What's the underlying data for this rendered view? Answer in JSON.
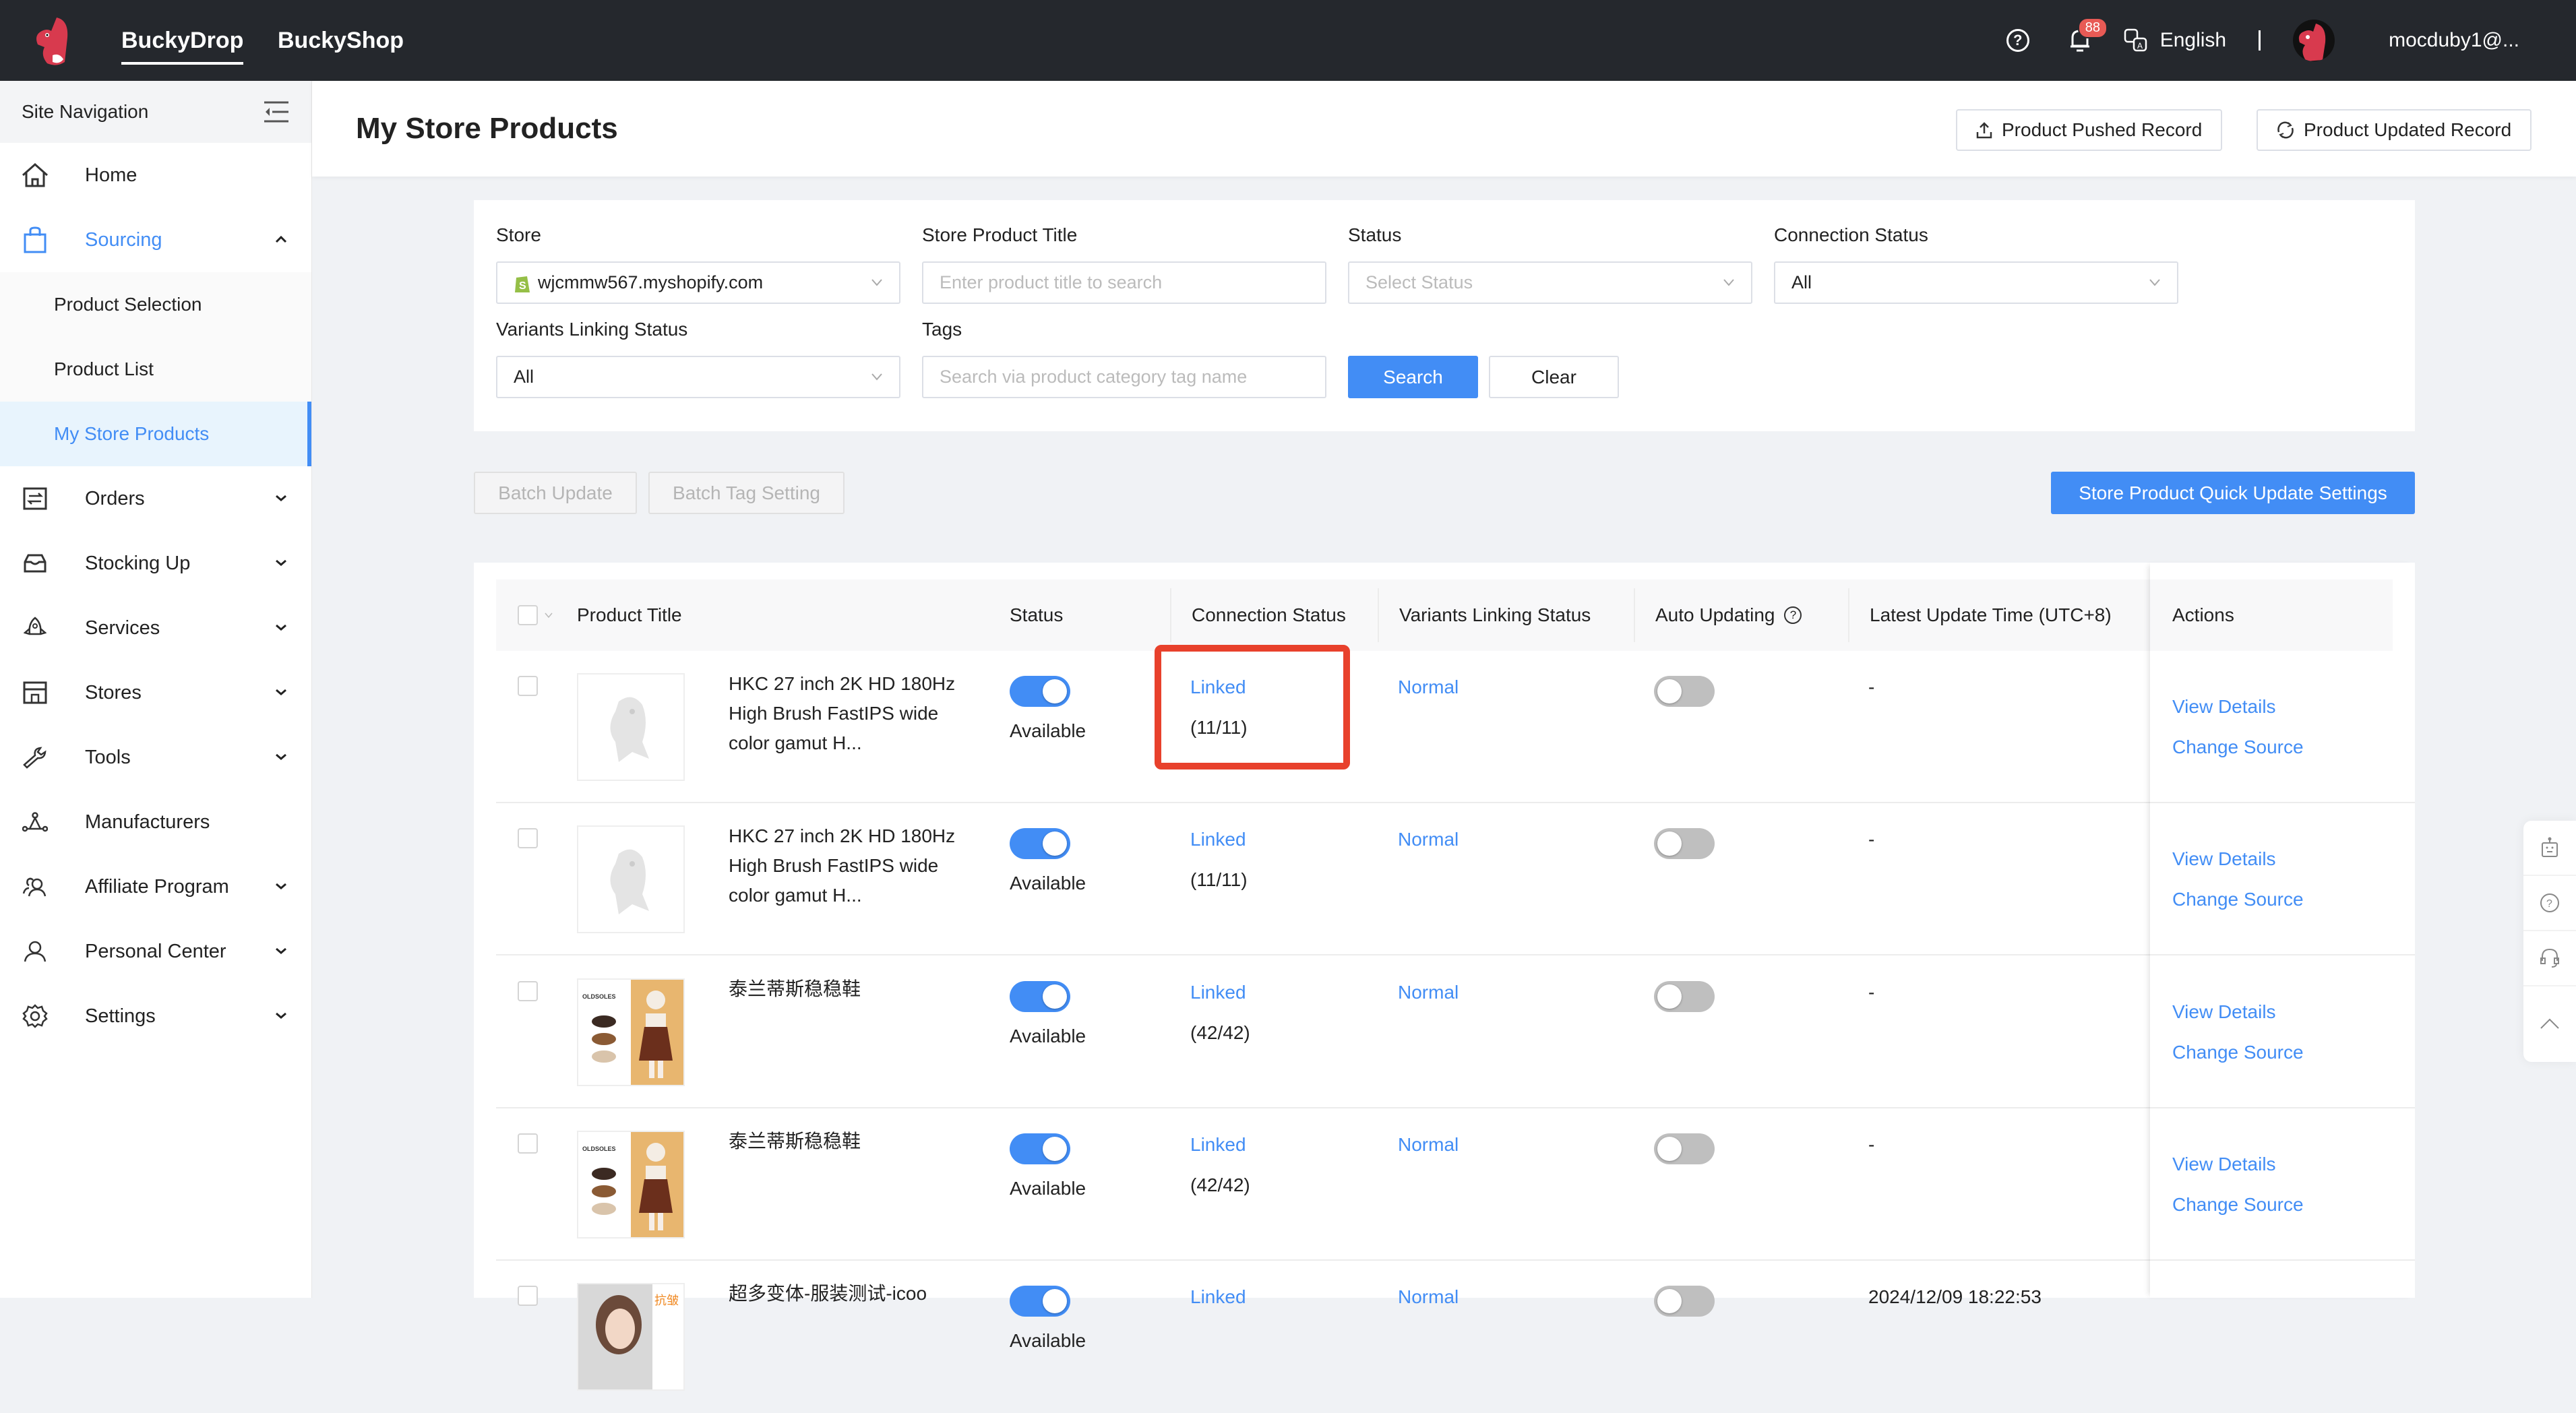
{
  "topbar": {
    "nav": [
      {
        "label": "BuckyDrop",
        "active": true
      },
      {
        "label": "BuckyShop",
        "active": false
      }
    ],
    "notification_count": "88",
    "language": "English",
    "username": "mocduby1@..."
  },
  "sidebar": {
    "title": "Site Navigation",
    "items": [
      {
        "label": "Home",
        "icon": "home-icon"
      },
      {
        "label": "Sourcing",
        "icon": "shopping-bag-icon",
        "expanded": true,
        "children": [
          {
            "label": "Product Selection"
          },
          {
            "label": "Product List"
          },
          {
            "label": "My Store Products",
            "selected": true
          }
        ]
      },
      {
        "label": "Orders",
        "icon": "orders-icon"
      },
      {
        "label": "Stocking Up",
        "icon": "inbox-icon"
      },
      {
        "label": "Services",
        "icon": "rocket-icon"
      },
      {
        "label": "Stores",
        "icon": "store-icon"
      },
      {
        "label": "Tools",
        "icon": "wrench-icon"
      },
      {
        "label": "Manufacturers",
        "icon": "network-icon"
      },
      {
        "label": "Affiliate Program",
        "icon": "users-icon"
      },
      {
        "label": "Personal Center",
        "icon": "user-icon"
      },
      {
        "label": "Settings",
        "icon": "gear-icon"
      }
    ]
  },
  "page": {
    "title": "My Store Products",
    "pushed_record_label": "Product Pushed Record",
    "updated_record_label": "Product Updated Record"
  },
  "filters": {
    "store_label": "Store",
    "store_value": "wjcmmw567.myshopify.com",
    "title_label": "Store Product Title",
    "title_placeholder": "Enter product title to search",
    "status_label": "Status",
    "status_placeholder": "Select Status",
    "connection_label": "Connection Status",
    "connection_value": "All",
    "variants_label": "Variants Linking Status",
    "variants_value": "All",
    "tags_label": "Tags",
    "tags_placeholder": "Search via product category tag name",
    "search_label": "Search",
    "clear_label": "Clear"
  },
  "toolbar": {
    "batch_update": "Batch Update",
    "batch_tag": "Batch Tag Setting",
    "quick_update": "Store Product Quick Update Settings"
  },
  "table": {
    "columns": [
      "Product Title",
      "Status",
      "Connection Status",
      "Variants Linking Status",
      "Auto Updating",
      "Latest Update Time (UTC+8)",
      "Actions"
    ],
    "rows": [
      {
        "title": "HKC 27 inch 2K HD 180Hz High Brush FastIPS wide color gamut H...",
        "title_lines": [
          "HKC 27 inch 2K HD 180Hz",
          "High Brush FastIPS wide",
          "color gamut H..."
        ],
        "status_on": true,
        "status": "Available",
        "connection": "Linked",
        "count": "(11/11)",
        "variants": "Normal",
        "auto_update": false,
        "updated": "-",
        "view": "View Details",
        "change": "Change Source",
        "thumb": "placeholder"
      },
      {
        "title": "HKC 27 inch 2K HD 180Hz High Brush FastIPS wide color gamut H...",
        "title_lines": [
          "HKC 27 inch 2K HD 180Hz",
          "High Brush FastIPS wide",
          "color gamut H..."
        ],
        "status_on": true,
        "status": "Available",
        "connection": "Linked",
        "count": "(11/11)",
        "variants": "Normal",
        "auto_update": false,
        "updated": "-",
        "view": "View Details",
        "change": "Change Source",
        "thumb": "placeholder"
      },
      {
        "title": "泰兰蒂斯稳稳鞋",
        "title_lines": [
          "泰兰蒂斯稳稳鞋"
        ],
        "status_on": true,
        "status": "Available",
        "connection": "Linked",
        "count": "(42/42)",
        "variants": "Normal",
        "auto_update": false,
        "updated": "-",
        "view": "View Details",
        "change": "Change Source",
        "thumb": "shoes"
      },
      {
        "title": "泰兰蒂斯稳稳鞋",
        "title_lines": [
          "泰兰蒂斯稳稳鞋"
        ],
        "status_on": true,
        "status": "Available",
        "connection": "Linked",
        "count": "(42/42)",
        "variants": "Normal",
        "auto_update": false,
        "updated": "-",
        "view": "View Details",
        "change": "Change Source",
        "thumb": "shoes"
      },
      {
        "title": "超多变体-服装测试-icoo",
        "title_lines": [
          "超多变体-服装测试-icoo"
        ],
        "status_on": true,
        "status": "Available",
        "connection": "Linked",
        "count": "",
        "variants": "Normal",
        "auto_update": false,
        "updated": "2024/12/09 18:22:53",
        "view": "",
        "change": "",
        "thumb": "portrait"
      }
    ]
  },
  "colors": {
    "accent": "#428df5",
    "topbar": "#25282d",
    "highlight": "#e8412c",
    "badge": "#e85a55"
  }
}
